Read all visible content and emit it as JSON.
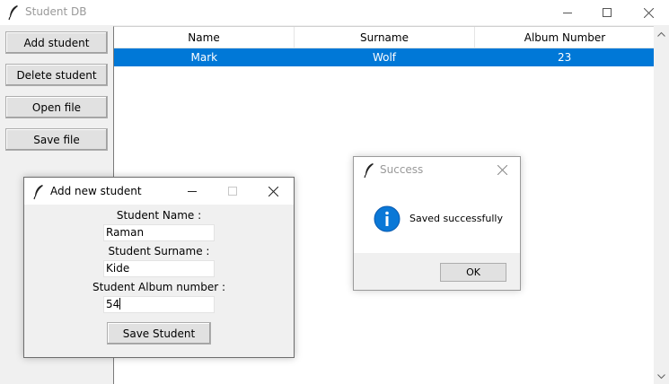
{
  "window": {
    "title": "Student DB"
  },
  "sidebar": {
    "buttons": [
      "Add student",
      "Delete student",
      "Open file",
      "Save file"
    ]
  },
  "table": {
    "columns": [
      "Name",
      "Surname",
      "Album Number"
    ],
    "rows": [
      {
        "name": "Mark",
        "surname": "Wolf",
        "album": "23",
        "selected": true
      }
    ]
  },
  "add_dialog": {
    "title": "Add new student",
    "name_label": "Student Name :",
    "name_value": "Raman",
    "surname_label": "Student Surname :",
    "surname_value": "Kide",
    "album_label": "Student Album number :",
    "album_value": "54",
    "save_label": "Save Student"
  },
  "success_dialog": {
    "title": "Success",
    "message": "Saved successfully",
    "ok_label": "OK"
  },
  "colors": {
    "selection": "#0078d7",
    "info_icon": "#0a78d7"
  }
}
